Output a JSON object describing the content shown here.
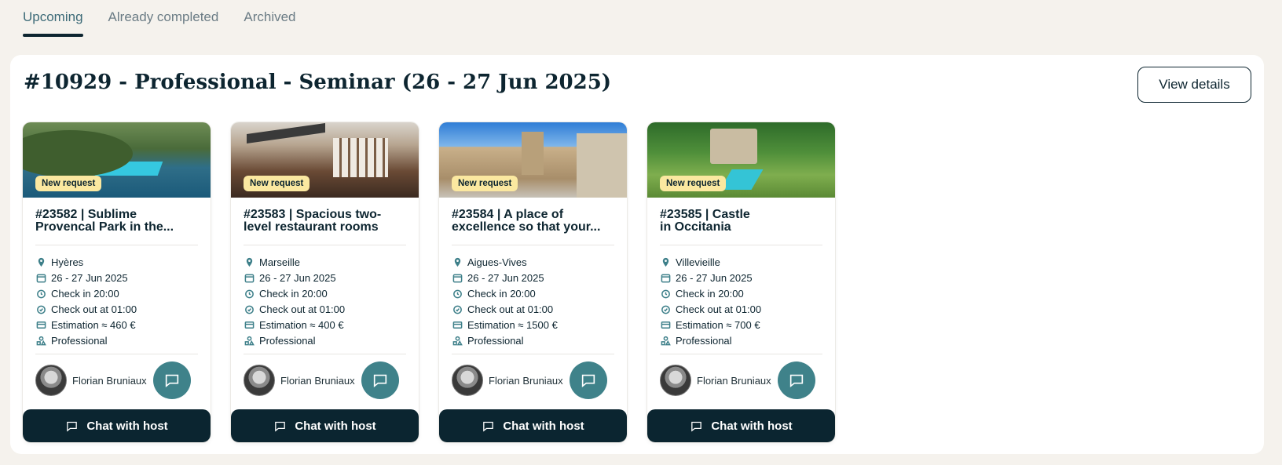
{
  "tabs": [
    {
      "label": "Upcoming",
      "active": true
    },
    {
      "label": "Already completed",
      "active": false
    },
    {
      "label": "Archived",
      "active": false
    }
  ],
  "event": {
    "title": "#10929 - Professional - Seminar (26 - 27 Jun 2025)",
    "view_details_label": "View details"
  },
  "cards": [
    {
      "badge": "New request",
      "title_line1": "#23582 | Sublime",
      "title_line2": "Provencal Park in the...",
      "location": "Hyères",
      "dates": "26 - 27 Jun 2025",
      "check_in": "Check in 20:00",
      "check_out": "Check out at 01:00",
      "estimation": "Estimation ≈ 460 €",
      "category": "Professional",
      "host": "Florian Bruniaux",
      "chat_label": "Chat with host"
    },
    {
      "badge": "New request",
      "title_line1": "#23583 | Spacious two-",
      "title_line2": "level restaurant rooms",
      "location": "Marseille",
      "dates": "26 - 27 Jun 2025",
      "check_in": "Check in 20:00",
      "check_out": "Check out at 01:00",
      "estimation": "Estimation ≈ 400 €",
      "category": "Professional",
      "host": "Florian Bruniaux",
      "chat_label": "Chat with host"
    },
    {
      "badge": "New request",
      "title_line1": "#23584 | A place of",
      "title_line2": "excellence so that your...",
      "location": "Aigues-Vives",
      "dates": "26 - 27 Jun 2025",
      "check_in": "Check in 20:00",
      "check_out": "Check out at 01:00",
      "estimation": "Estimation ≈ 1500 €",
      "category": "Professional",
      "host": "Florian Bruniaux",
      "chat_label": "Chat with host"
    },
    {
      "badge": "New request",
      "title_line1": "#23585 | Castle",
      "title_line2": "in Occitania",
      "location": "Villevieille",
      "dates": "26 - 27 Jun 2025",
      "check_in": "Check in 20:00",
      "check_out": "Check out at 01:00",
      "estimation": "Estimation ≈ 700 €",
      "category": "Professional",
      "host": "Florian Bruniaux",
      "chat_label": "Chat with host"
    }
  ],
  "icons": {
    "location": "map-pin-icon",
    "dates": "calendar-icon",
    "check_in": "alarm-clock-icon",
    "check_out": "alarm-clock-icon",
    "estimation": "credit-card-icon",
    "category": "shapes-icon",
    "message": "chat-bubble-icon"
  },
  "colors": {
    "background": "#f5f2ed",
    "primary_dark": "#0b2530",
    "teal": "#3f828a",
    "badge": "#fbe8a0"
  }
}
